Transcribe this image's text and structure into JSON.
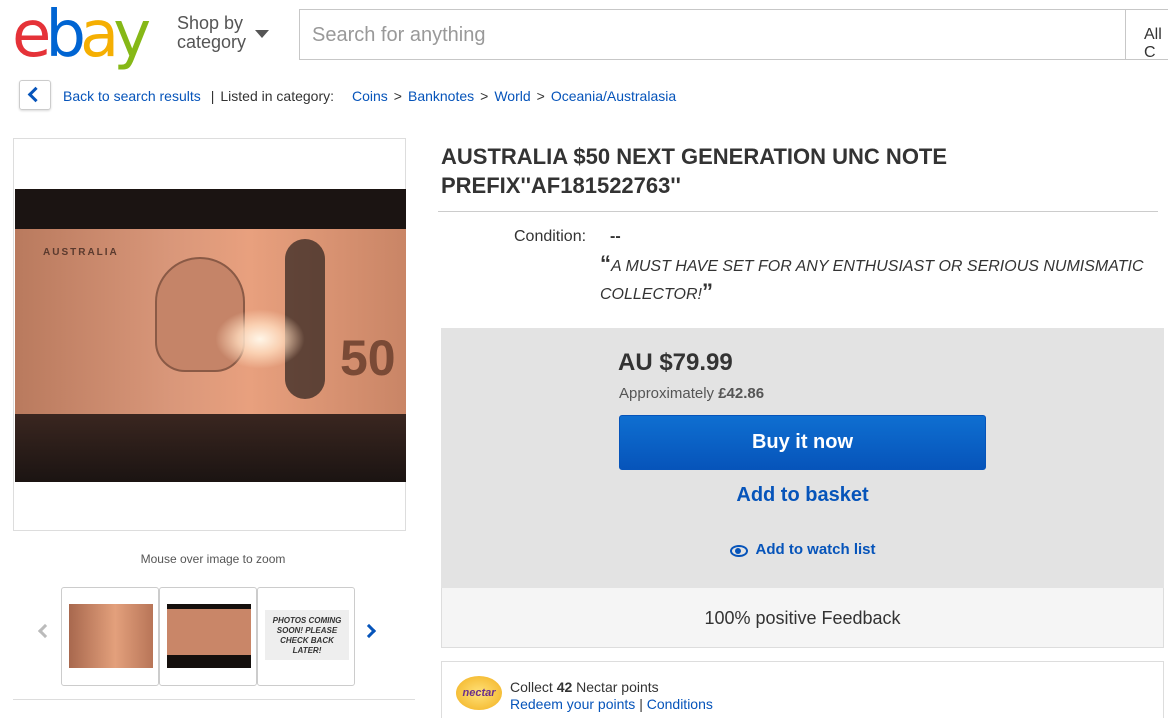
{
  "header": {
    "logo_letters": [
      "e",
      "b",
      "a",
      "y"
    ],
    "shop_by_line1": "Shop by",
    "shop_by_line2": "category",
    "search_placeholder": "Search for anything",
    "category_select": "All C"
  },
  "breadcrumb": {
    "back_label": "Back to search results",
    "listed_label": "Listed in category:",
    "items": [
      "Coins",
      "Banknotes",
      "World",
      "Oceania/Australasia"
    ],
    "separator": ">"
  },
  "gallery": {
    "note_text": "AUSTRALIA",
    "note_value": "50",
    "zoom_hint": "Mouse over image to zoom",
    "thumb_soon_text": "PHOTOS COMING SOON! PLEASE CHECK BACK LATER!"
  },
  "item": {
    "title": "AUSTRALIA $50 NEXT GENERATION UNC NOTE PREFIX''AF181522763''",
    "condition_label": "Condition:",
    "condition_value": "--",
    "quote_open": "“",
    "quote_text": "A MUST HAVE SET FOR ANY ENTHUSIAST OR SERIOUS NUMISMATIC COLLECTOR!",
    "quote_close": "”"
  },
  "purchase": {
    "price": "AU $79.99",
    "approx_label": "Approximately",
    "approx_value": "£42.86",
    "buy_now": "Buy it now",
    "add_basket": "Add to basket",
    "add_watch": "Add to watch list",
    "feedback": "100% positive Feedback"
  },
  "nectar": {
    "logo_text": "nectar",
    "collect_prefix": "Collect",
    "points": "42",
    "collect_suffix": "Nectar points",
    "redeem_link": "Redeem your points",
    "divider": "|",
    "conditions_link": "Conditions"
  },
  "colors": {
    "link_blue": "#0654ba",
    "buy_button": "#0654ba",
    "panel_grey": "#e3e3e3"
  }
}
